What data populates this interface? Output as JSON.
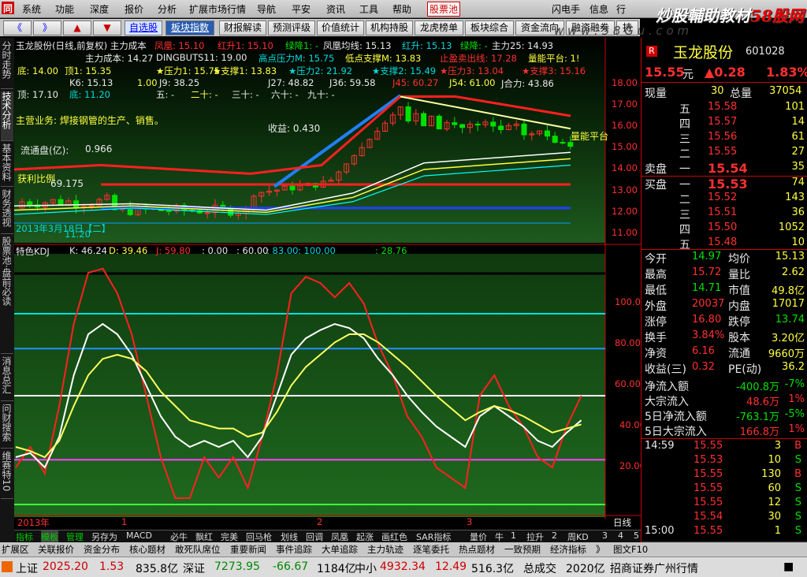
{
  "menu": [
    "系统",
    "功能",
    "深度",
    "报价",
    "分析",
    "扩展市场行情",
    "导航",
    "平安",
    "资讯",
    "工具",
    "帮助"
  ],
  "menu_highlight": "股票池",
  "menu_right": [
    "闪电手",
    "信息",
    "行"
  ],
  "watermark": {
    "prefix": "炒股輔助教材",
    "site": "58股网",
    "url": "w w w . 5 8 G u . c o m"
  },
  "toolbar": {
    "nav": [
      "《",
      "》",
      "▲",
      "▼"
    ],
    "links": [
      "自选股",
      "板块指数"
    ],
    "buttons": [
      "财报解读",
      "预测评级",
      "价值统计",
      "机构持股",
      "龙虎榜单",
      "板块综合",
      "资金流向",
      "融资融券",
      "持"
    ]
  },
  "left_tabs": [
    "分时走势",
    "技术分析",
    "基本资料",
    "财务透视",
    "股票池·盘前必读",
    "消息总汇",
    "问财搜索",
    "维赛特10"
  ],
  "main_chart": {
    "title": "玉龙股份(日线,前复权) 主力成本",
    "line1": [
      "凤凰: 15.10",
      "红升1: 15.10",
      "绿降1: -",
      "凤凰均线: 15.13",
      "红升: 15.13",
      "绿降: -",
      "主力25: 14.93"
    ],
    "line2": [
      "主力成本: 14.27",
      "DINGBUTS11: 19.00",
      "高点压力M: 15.75",
      "低点支撑M: 13.83",
      "止盈卖出线: 17.28",
      "量能平台: 1!"
    ],
    "line3": [
      "底: 14.00",
      "顶1: 15.35",
      "★压力1: 15.75",
      "★支撑1: 13.83",
      "★压力2: 21.92",
      "★支撑2: 15.49",
      "★压力3: 13.04",
      "★支撑3: 15.16"
    ],
    "line4": [
      "K6: 15.13",
      "1.00",
      "J9: 38.25",
      "J27: 48.82",
      "J36: 59.58",
      "J45: 60.27",
      "J54: 61.00",
      "J合力: 43.86"
    ],
    "line5": [
      "顶: 17.10",
      "底: 11.20",
      "五: -",
      "二十: -",
      "三十: -",
      "六十: -",
      "九十: -"
    ],
    "notes": [
      "主营业务: 焊接钢管的生产、销售。",
      "流通盘(亿):",
      "0.966",
      "获利比例",
      "69.175",
      "收益: 0.430",
      "量能平台",
      "2013年3月18日【二】",
      "11.20"
    ],
    "price_ticks": [
      "18.00",
      "17.00",
      "16.00",
      "15.00",
      "14.00",
      "13.00",
      "12.00",
      "11.00"
    ]
  },
  "kdj": {
    "label": "特色KDJ",
    "values": [
      "K: 46.24",
      "D: 39.46",
      "J: 59.80",
      ": 0.00",
      ": 60.00",
      ": 83.00",
      ": 100.00",
      ": 28.76"
    ],
    "ticks": [
      "100.00",
      "80.00",
      "60.00",
      "40.00",
      "20.00"
    ],
    "x_axis": [
      "2013年",
      "1",
      "2",
      "3"
    ],
    "period": "日线"
  },
  "bottom_toolbar": [
    "指标",
    "模板",
    "管理",
    "另存为",
    "MACD",
    "必牛",
    "飘红",
    "完美",
    "回马枪",
    "划线",
    "回调",
    "凤凰",
    "起涨",
    "画红色",
    "SAR指标",
    "量价",
    "牛",
    "1",
    "拉升",
    "2",
    "周KD",
    "3",
    "4",
    "5",
    "6"
  ],
  "stock": {
    "marker": "R",
    "name": "玉龙股份",
    "code": "601028",
    "price": "15.55",
    "price_unit": "元",
    "change": "▲0.28",
    "change_pct": "1.83%",
    "now_label": "现量",
    "now_vol": "30",
    "total_label": "总量",
    "total_vol": "37054",
    "sell_label": "卖盘",
    "buy_label": "买盘",
    "asks": [
      {
        "lvl": "五",
        "price": "15.58",
        "vol": "101"
      },
      {
        "lvl": "四",
        "price": "15.57",
        "vol": "14"
      },
      {
        "lvl": "三",
        "price": "15.56",
        "vol": "61"
      },
      {
        "lvl": "二",
        "price": "15.55",
        "vol": "27"
      },
      {
        "lvl": "一",
        "price": "15.54",
        "vol": "35"
      }
    ],
    "bids": [
      {
        "lvl": "一",
        "price": "15.53",
        "vol": "74"
      },
      {
        "lvl": "二",
        "price": "15.52",
        "vol": "143"
      },
      {
        "lvl": "三",
        "price": "15.51",
        "vol": "36"
      },
      {
        "lvl": "四",
        "price": "15.50",
        "vol": "1052"
      },
      {
        "lvl": "五",
        "price": "15.48",
        "vol": "10"
      }
    ],
    "stats": [
      {
        "l1": "今开",
        "v1": "14.97",
        "l2": "均价",
        "v2": "15.13"
      },
      {
        "l1": "最高",
        "v1": "15.72",
        "l2": "量比",
        "v2": "2.62"
      },
      {
        "l1": "最低",
        "v1": "14.71",
        "l2": "市值",
        "v2": "49.8亿"
      },
      {
        "l1": "外盘",
        "v1": "20037",
        "l2": "内盘",
        "v2": "17017"
      },
      {
        "l1": "涨停",
        "v1": "16.80",
        "l2": "跌停",
        "v2": "13.74"
      },
      {
        "l1": "换手",
        "v1": "3.84%",
        "l2": "股本",
        "v2": "3.20亿"
      },
      {
        "l1": "净资",
        "v1": "6.16",
        "l2": "流通",
        "v2": "9660万"
      },
      {
        "l1": "收益(三)",
        "v1": "0.32",
        "l2": "PE(动)",
        "v2": "36.2"
      }
    ],
    "flows": [
      {
        "l": "净流入额",
        "v": "-400.8万",
        "p": "-7%"
      },
      {
        "l": "大宗流入",
        "v": "48.6万",
        "p": "1%"
      },
      {
        "l": "5日净流入额",
        "v": "-763.1万",
        "p": "-5%"
      },
      {
        "l": "5日大宗流入",
        "v": "166.8万",
        "p": "1%"
      }
    ],
    "ticks": [
      {
        "t": "14:59",
        "p": "15.55",
        "v": "3",
        "d": "B"
      },
      {
        "t": "",
        "p": "15.53",
        "v": "10",
        "d": "S"
      },
      {
        "t": "",
        "p": "15.55",
        "v": "130",
        "d": "B"
      },
      {
        "t": "",
        "p": "15.55",
        "v": "60",
        "d": "S"
      },
      {
        "t": "",
        "p": "15.55",
        "v": "12",
        "d": "S"
      },
      {
        "t": "",
        "p": "15.54",
        "v": "30",
        "d": "S"
      },
      {
        "t": "15:00",
        "p": "15.55",
        "v": "1",
        "d": "S"
      }
    ],
    "panel_tabs": [
      "笔",
      "价",
      "细",
      "盘",
      "势",
      "指",
      "值",
      "主"
    ]
  },
  "bottom_tabs": [
    "扩展区",
    "关联报价",
    "资金分布",
    "核心题材",
    "敢死队席位",
    "重要新闻",
    "事件追踪",
    "大单追踪",
    "主力轨迹",
    "逐笔委托",
    "热点题材",
    "一致预期",
    "经济指标",
    "》",
    "图文F10"
  ],
  "status": {
    "sh_label": "上证",
    "sh_val": "2025.20",
    "sh_chg": "1.53",
    "sh_amt": "835.8亿",
    "sz_label": "深证",
    "sz_val": "7273.95",
    "sz_chg": "-66.67",
    "sz_amt": "1184亿",
    "zx_label": "中小",
    "zx_val": "4932.34",
    "zx_chg": "12.49",
    "zx_amt": "516.3亿",
    "total_label": "总成交",
    "total_amt": "2020亿",
    "broker": "招商证券广州行情"
  },
  "colors": {
    "up": "#ff3030",
    "down": "#00e000",
    "accent": "#c00000",
    "bg": "#000000"
  }
}
